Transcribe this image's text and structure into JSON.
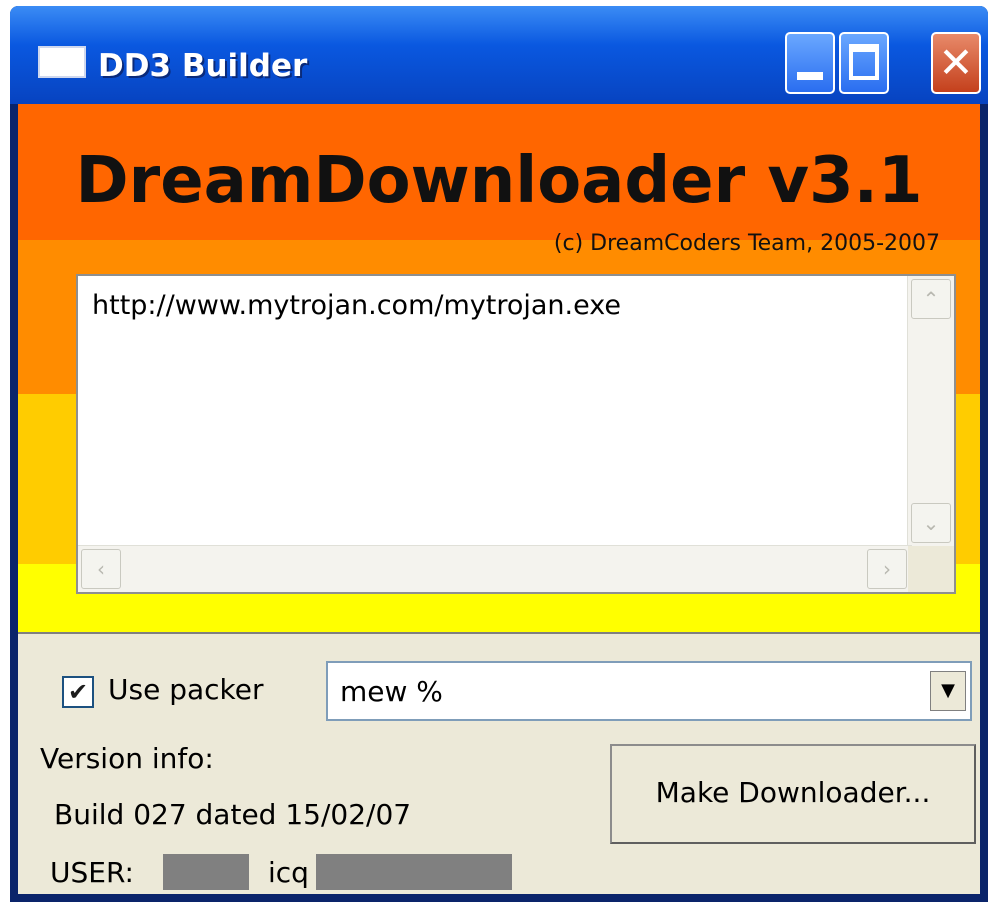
{
  "window": {
    "title": "DD3 Builder"
  },
  "titlebar_buttons": {
    "minimize_icon": "minimize-icon",
    "maximize_icon": "maximize-icon",
    "close_icon": "close-icon",
    "close_glyph": "✕"
  },
  "banner": {
    "app_title": "DreamDownloader v3.1",
    "copyright": "(c) DreamCoders Team, 2005-2007",
    "stripe_colors": [
      "#ff6600",
      "#ff8c00",
      "#ffcc00",
      "#ffff00"
    ]
  },
  "url_list": {
    "text": "http://www.mytrojan.com/mytrojan.exe"
  },
  "scrollbars": {
    "up": "⌃",
    "down": "⌄",
    "left": "‹",
    "right": "›"
  },
  "options": {
    "use_packer_label": "Use packer",
    "use_packer_checked": true,
    "check_mark": "✔",
    "packer_value": "mew %",
    "dropdown_arrow": "▼"
  },
  "info": {
    "version_label": "Version info:",
    "build": "Build 027 dated 15/02/07",
    "user_label": "USER:",
    "icq_label": "icq"
  },
  "actions": {
    "make_label": "Make Downloader..."
  }
}
